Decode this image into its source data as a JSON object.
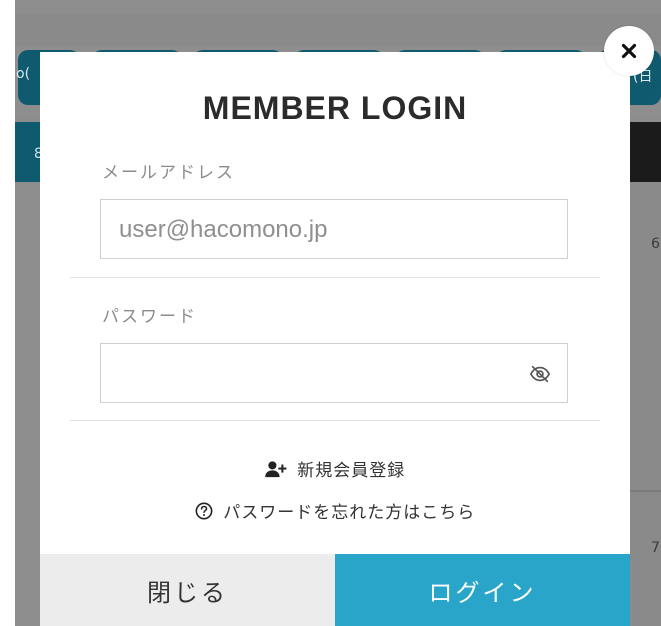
{
  "background": {
    "tab_fragment_left": "o(",
    "tab_fragment_right": "(日",
    "side_char_left": "8",
    "right_number_1": "6",
    "right_number_2": "7"
  },
  "modal": {
    "title": "MEMBER LOGIN",
    "email": {
      "label": "メールアドレス",
      "placeholder": "user@hacomono.jp",
      "value": ""
    },
    "password": {
      "label": "パスワード",
      "placeholder": "",
      "value": ""
    },
    "links": {
      "register": "新規会員登録",
      "forgot_password": "パスワードを忘れた方はこちら"
    },
    "buttons": {
      "close": "閉じる",
      "login": "ログイン"
    },
    "icons": {
      "close": "close-icon",
      "password_toggle": "eye-slash-icon",
      "register": "user-plus-icon",
      "forgot": "question-circle-icon"
    }
  },
  "colors": {
    "accent": "#29a5c9",
    "close_button_bg": "#ececec",
    "overlay_dark": "#0f5a6e"
  }
}
